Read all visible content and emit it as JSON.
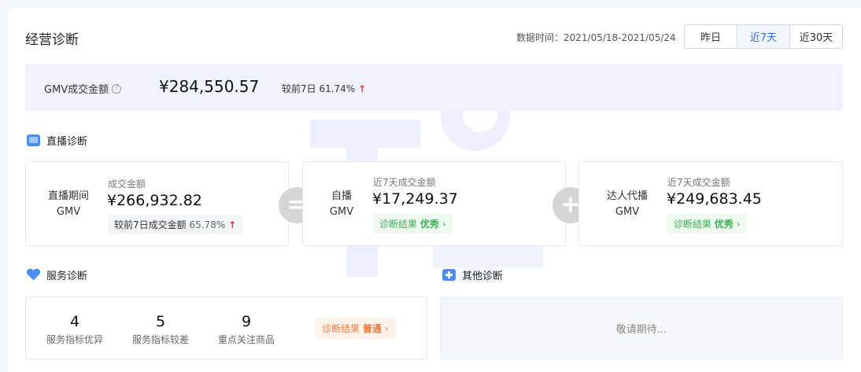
{
  "header": {
    "title": "经营诊断",
    "range_label": "数据时间：2021/05/18-2021/05/24",
    "tabs": [
      {
        "label": "昨日",
        "active": false
      },
      {
        "label": "近7天",
        "active": true
      },
      {
        "label": "近30天",
        "active": false
      }
    ]
  },
  "gmv": {
    "label": "GMV成交金额",
    "value": "¥284,550.57",
    "compare": "较前7日 61.74%",
    "arrow": "↑"
  },
  "live": {
    "section_title": "直播诊断",
    "total": {
      "label_line1": "直播期间",
      "label_line2": "GMV",
      "sub_label": "成交金额",
      "value": "¥266,932.82",
      "compare_label": "较前7日成交金额",
      "compare_pct": "65.78%",
      "arrow": "↑"
    },
    "equals": "=",
    "self": {
      "label_line1": "自播",
      "label_line2": "GMV",
      "sub_label": "近7天成交金额",
      "value": "¥17,249.37",
      "result_prefix": "诊断结果",
      "result": "优秀",
      "chevron": "›"
    },
    "plus": "+",
    "talent": {
      "label_line1": "达人代播",
      "label_line2": "GMV",
      "sub_label": "近7天成交金额",
      "value": "¥249,683.45",
      "result_prefix": "诊断结果",
      "result": "优秀",
      "chevron": "›"
    }
  },
  "service": {
    "section_title": "服务诊断",
    "stats": [
      {
        "value": "4",
        "label": "服务指标优异"
      },
      {
        "value": "5",
        "label": "服务指标较差"
      },
      {
        "value": "9",
        "label": "重点关注商品"
      }
    ],
    "result_prefix": "诊断结果",
    "result": "普通",
    "chevron": "›"
  },
  "other": {
    "section_title": "其他诊断",
    "pending": "敬请期待..."
  },
  "colors": {
    "accent": "#3a6ad8",
    "up": "#e5322d",
    "good": "#3fae55",
    "mid": "#f07b3c"
  }
}
